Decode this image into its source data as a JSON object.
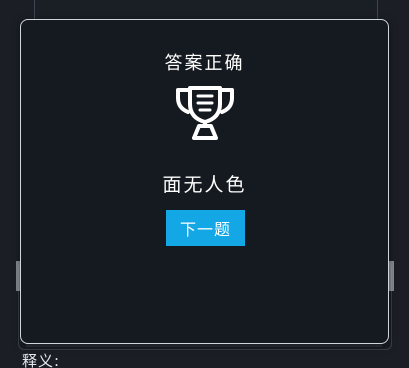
{
  "modal": {
    "title": "答案正确",
    "icon": "trophy-icon",
    "answer": "面无人色",
    "next_label": "下一题"
  },
  "background": {
    "label": "释义:"
  },
  "colors": {
    "accent": "#13a7e6",
    "modal_bg": "#151a20",
    "page_bg": "#1b1f25",
    "text": "#ffffff"
  }
}
